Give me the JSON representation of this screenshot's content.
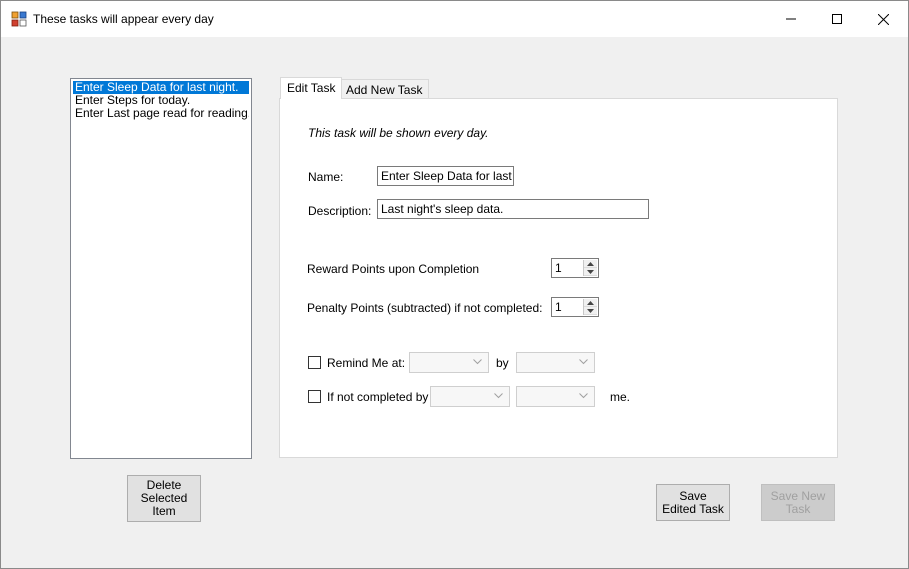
{
  "window": {
    "title": "These tasks will appear every day",
    "icon": "app-window-icon"
  },
  "task_list": {
    "items": [
      "Enter Sleep Data for last night.",
      "Enter Steps for today.",
      "Enter Last page read for reading."
    ],
    "selected_index": 0
  },
  "tabs": [
    {
      "label": "Edit Task",
      "active": true
    },
    {
      "label": "Add New Task",
      "active": false
    }
  ],
  "edit_task": {
    "info": "This task will be shown every day.",
    "name_label": "Name:",
    "name_value": "Enter Sleep Data for last nig",
    "description_label": "Description:",
    "description_value": "Last night's sleep data.",
    "reward_label": "Reward Points upon Completion",
    "reward_value": "1",
    "penalty_label": "Penalty Points (subtracted) if not completed:",
    "penalty_value": "1",
    "remind_label": "Remind Me at:",
    "by_label": "by",
    "not_completed_label": "If not completed by",
    "me_label": "me."
  },
  "buttons": {
    "delete": "Delete Selected Item",
    "save_edited": "Save Edited Task",
    "save_new": "Save New Task"
  },
  "colors": {
    "selection": "#0078d7",
    "disabled_text": "#a0a0a0"
  }
}
